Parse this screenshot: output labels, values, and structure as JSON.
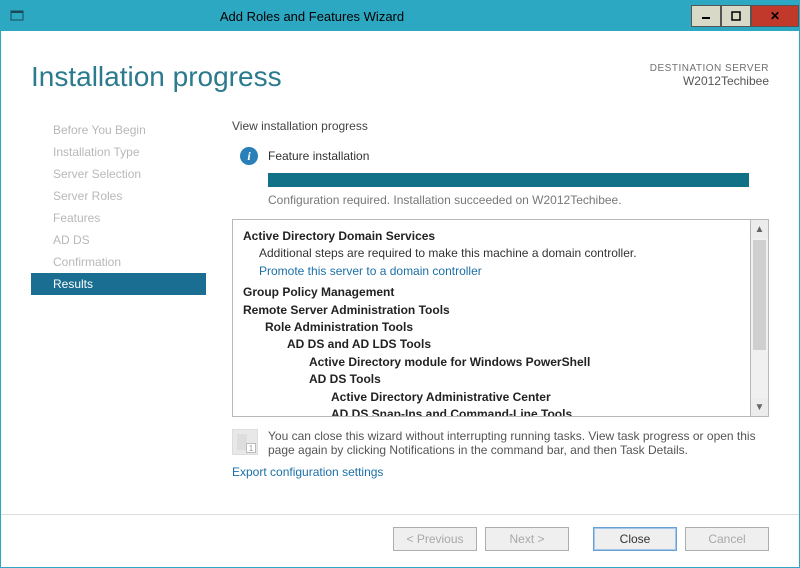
{
  "titlebar": {
    "title": "Add Roles and Features Wizard"
  },
  "header": {
    "page_title": "Installation progress",
    "dest_label": "DESTINATION SERVER",
    "dest_name": "W2012Techibee"
  },
  "sidebar": {
    "steps": [
      "Before You Begin",
      "Installation Type",
      "Server Selection",
      "Server Roles",
      "Features",
      "AD DS",
      "Confirmation",
      "Results"
    ],
    "active_index": 7
  },
  "main": {
    "view_label": "View installation progress",
    "status_title": "Feature installation",
    "status_detail": "Configuration required. Installation succeeded on W2012Techibee.",
    "tree": {
      "adds_title": "Active Directory Domain Services",
      "adds_sub": "Additional steps are required to make this machine a domain controller.",
      "adds_link": "Promote this server to a domain controller",
      "gpm": "Group Policy Management",
      "rsat": "Remote Server Administration Tools",
      "rat": "Role Administration Tools",
      "ad_lds": "AD DS and AD LDS Tools",
      "ad_ps": "Active Directory module for Windows PowerShell",
      "ad_tools": "AD DS Tools",
      "ad_ac": "Active Directory Administrative Center",
      "ad_snap": "AD DS Snap-Ins and Command-Line Tools"
    },
    "hint": "You can close this wizard without interrupting running tasks. View task progress or open this page again by clicking Notifications in the command bar, and then Task Details.",
    "export_link": "Export configuration settings",
    "flag_badge": "1"
  },
  "footer": {
    "prev": "< Previous",
    "next": "Next >",
    "close": "Close",
    "cancel": "Cancel"
  }
}
